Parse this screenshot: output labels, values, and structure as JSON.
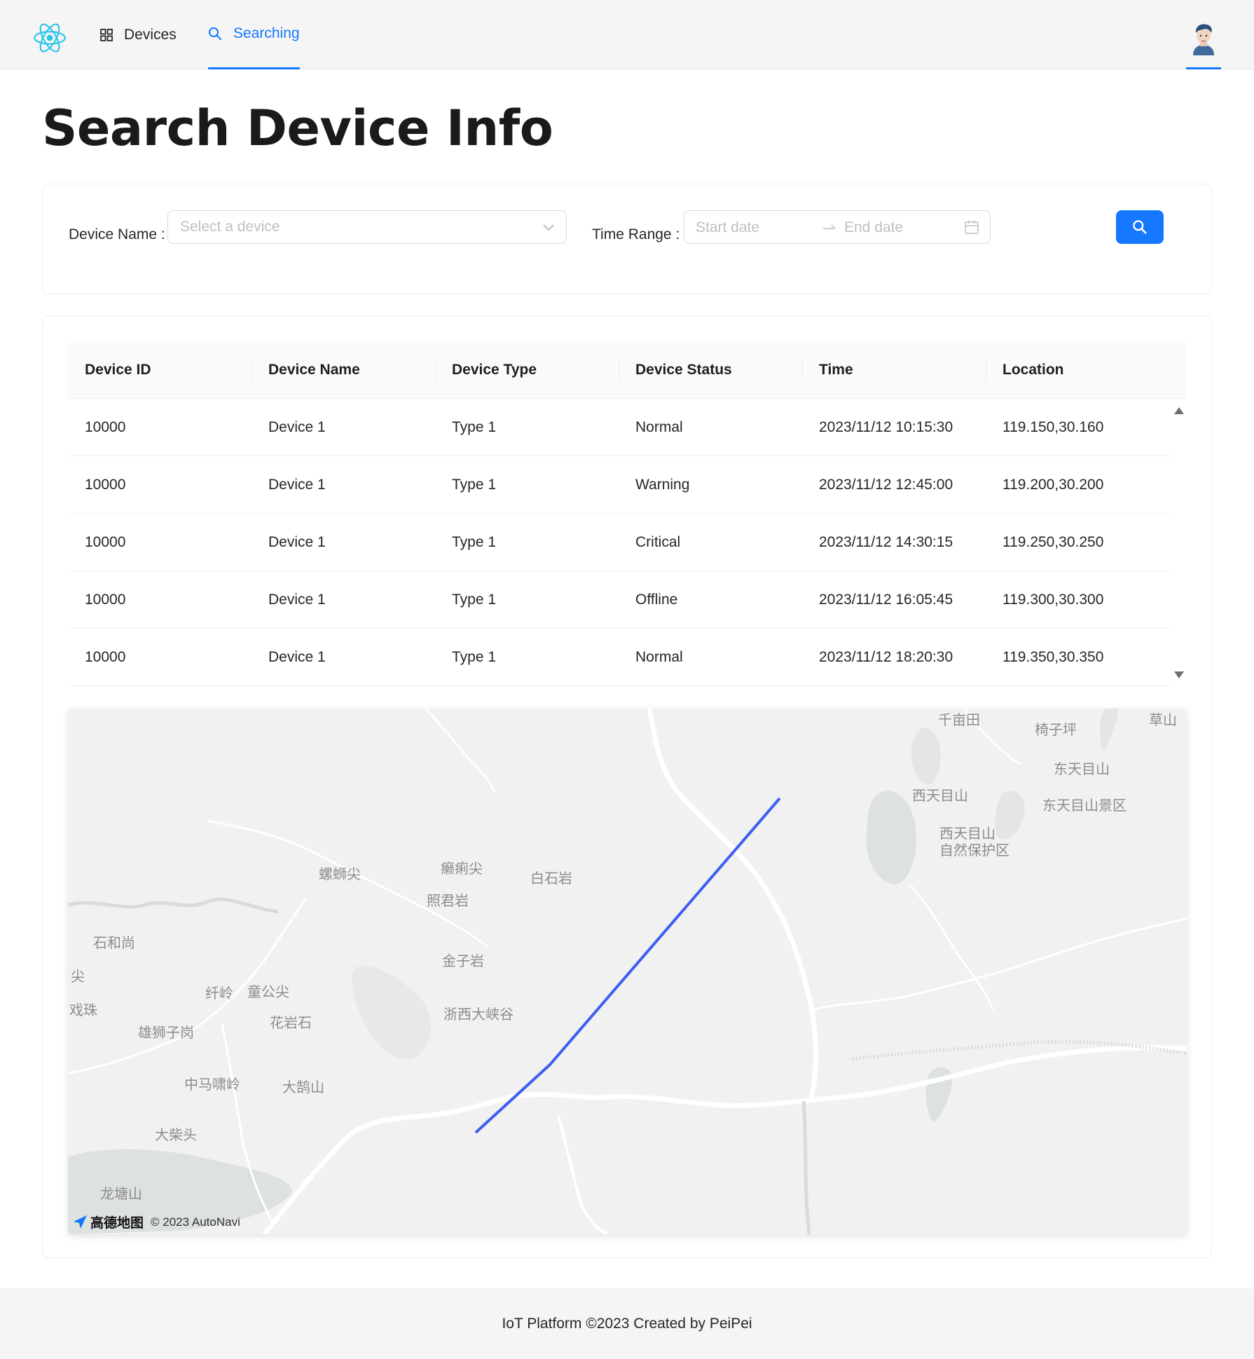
{
  "nav": {
    "items": [
      {
        "label": "Devices",
        "icon": "grid-icon"
      },
      {
        "label": "Searching",
        "icon": "search-icon",
        "active": true
      }
    ]
  },
  "page": {
    "title": "Search Device Info"
  },
  "filters": {
    "device_label": "Device Name",
    "device_placeholder": "Select a device",
    "time_label": "Time Range",
    "start_placeholder": "Start date",
    "end_placeholder": "End date"
  },
  "table": {
    "columns": [
      "Device ID",
      "Device Name",
      "Device Type",
      "Device Status",
      "Time",
      "Location"
    ],
    "rows": [
      [
        "10000",
        "Device 1",
        "Type 1",
        "Normal",
        "2023/11/12 10:15:30",
        "119.150,30.160"
      ],
      [
        "10000",
        "Device 1",
        "Type 1",
        "Warning",
        "2023/11/12 12:45:00",
        "119.200,30.200"
      ],
      [
        "10000",
        "Device 1",
        "Type 1",
        "Critical",
        "2023/11/12 14:30:15",
        "119.250,30.250"
      ],
      [
        "10000",
        "Device 1",
        "Type 1",
        "Offline",
        "2023/11/12 16:05:45",
        "119.300,30.300"
      ],
      [
        "10000",
        "Device 1",
        "Type 1",
        "Normal",
        "2023/11/12 18:20:30",
        "119.350,30.350"
      ]
    ]
  },
  "map": {
    "labels": [
      "千亩田",
      "椅子坪",
      "草山",
      "东天目山",
      "西天目山",
      "东天目山景区",
      "西天目山",
      "自然保护区",
      "螺蛳尖",
      "癞痢尖",
      "白石岩",
      "照君岩",
      "石和尚",
      "金子岩",
      "尖",
      "纤岭",
      "童公尖",
      "戏珠",
      "雄狮子岗",
      "花岩石",
      "浙西大峡谷",
      "中马啸岭",
      "大鹄山",
      "大柴头",
      "龙塘山"
    ],
    "brand": "高德地图",
    "copyright": "© 2023 AutoNavi",
    "route_color": "#3d5ef0"
  },
  "footer": {
    "text": "IoT Platform ©2023 Created by PeiPei"
  },
  "colors": {
    "primary": "#1677ff"
  }
}
